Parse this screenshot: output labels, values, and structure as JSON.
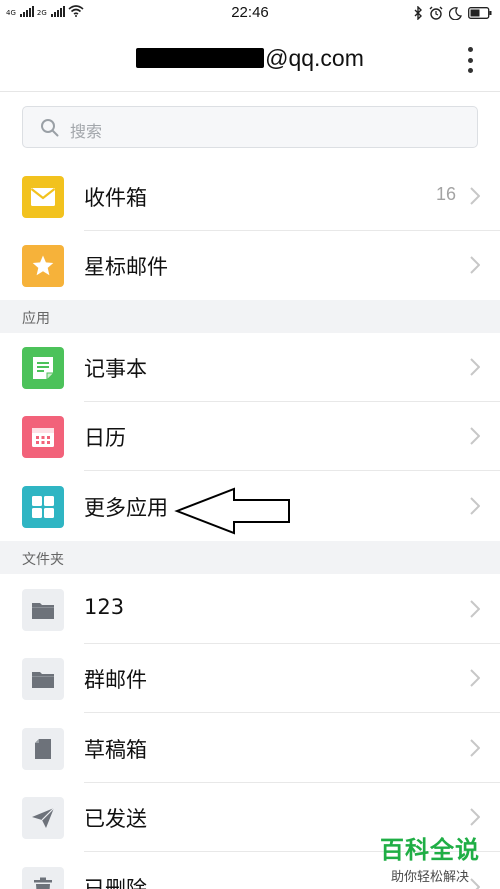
{
  "status": {
    "network_left": "4G",
    "network_right": "2G",
    "time": "22:46"
  },
  "header": {
    "account_visible": "@qq.com"
  },
  "search": {
    "placeholder": "搜索"
  },
  "mail_items": [
    {
      "label": "收件箱",
      "count": "16",
      "icon": "inbox-icon",
      "color": "#f2c21e"
    },
    {
      "label": "星标邮件",
      "count": "",
      "icon": "star-icon",
      "color": "#f6b23a"
    }
  ],
  "apps_section": {
    "title": "应用"
  },
  "app_items": [
    {
      "label": "记事本",
      "icon": "notes-icon",
      "color": "#4cc25a"
    },
    {
      "label": "日历",
      "icon": "calendar-icon",
      "color": "#f2627a"
    },
    {
      "label": "更多应用",
      "icon": "more-apps-icon",
      "color": "#2fb5c3"
    }
  ],
  "folders_section": {
    "title": "文件夹"
  },
  "folder_items": [
    {
      "label": "123",
      "icon": "folder-icon"
    },
    {
      "label": "群邮件",
      "icon": "folder-icon"
    },
    {
      "label": "草稿箱",
      "icon": "draft-icon"
    },
    {
      "label": "已发送",
      "icon": "sent-icon"
    },
    {
      "label": "已删除",
      "icon": "trash-icon"
    }
  ],
  "watermark": {
    "main": "百科全说",
    "sub": "助你轻松解决"
  }
}
